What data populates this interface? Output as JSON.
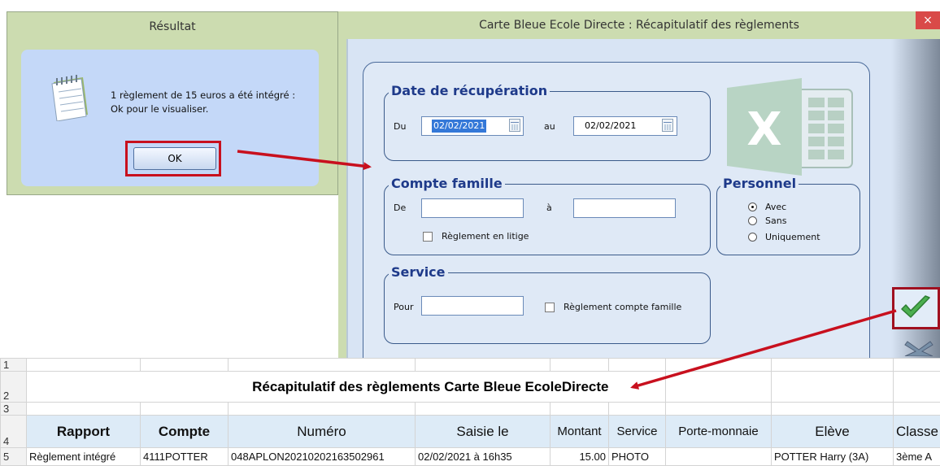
{
  "result_dialog": {
    "title": "Résultat",
    "message_line1": "1 règlement de 15 euros a été intégré :",
    "message_line2": "Ok pour le visualiser.",
    "ok_label": "OK"
  },
  "main_window": {
    "title": "Carte Bleue Ecole Directe : Récapitulatif des règlements",
    "close_label": "×",
    "date_group": {
      "title": "Date de récupération",
      "from_label": "Du",
      "from_value": "02/02/2021",
      "to_label": "au",
      "to_value": "02/02/2021"
    },
    "account_group": {
      "title": "Compte famille",
      "from_label": "De",
      "from_value": "",
      "to_label": "à",
      "to_value": "",
      "dispute_label": "Règlement en litige"
    },
    "staff_group": {
      "title": "Personnel",
      "options": [
        "Avec",
        "Sans",
        "Uniquement"
      ],
      "selected": "Avec"
    },
    "service_group": {
      "title": "Service",
      "for_label": "Pour",
      "for_value": "",
      "family_account_label": "Règlement compte famille"
    },
    "excel_icon_letter": "X"
  },
  "spreadsheet": {
    "row_numbers": [
      "1",
      "2",
      "3",
      "4",
      "5"
    ],
    "title": "Récapitulatif des règlements Carte Bleue EcoleDirecte",
    "headers": [
      "Rapport",
      "Compte",
      "Numéro",
      "Saisie le",
      "Montant",
      "Service",
      "Porte-monnaie",
      "Elève",
      "Classe"
    ],
    "rows": [
      [
        "Règlement intégré",
        "4111POTTER",
        "048APLON20210202163502961",
        "02/02/2021 à 16h35",
        "15.00",
        "PHOTO",
        "",
        "POTTER Harry (3A)",
        "3ème A"
      ]
    ]
  },
  "colors": {
    "highlight_red": "#c8101e",
    "group_title_blue": "#1e3a8a",
    "header_fill": "#ddebf7",
    "excel_green": "#2e7d4f"
  }
}
